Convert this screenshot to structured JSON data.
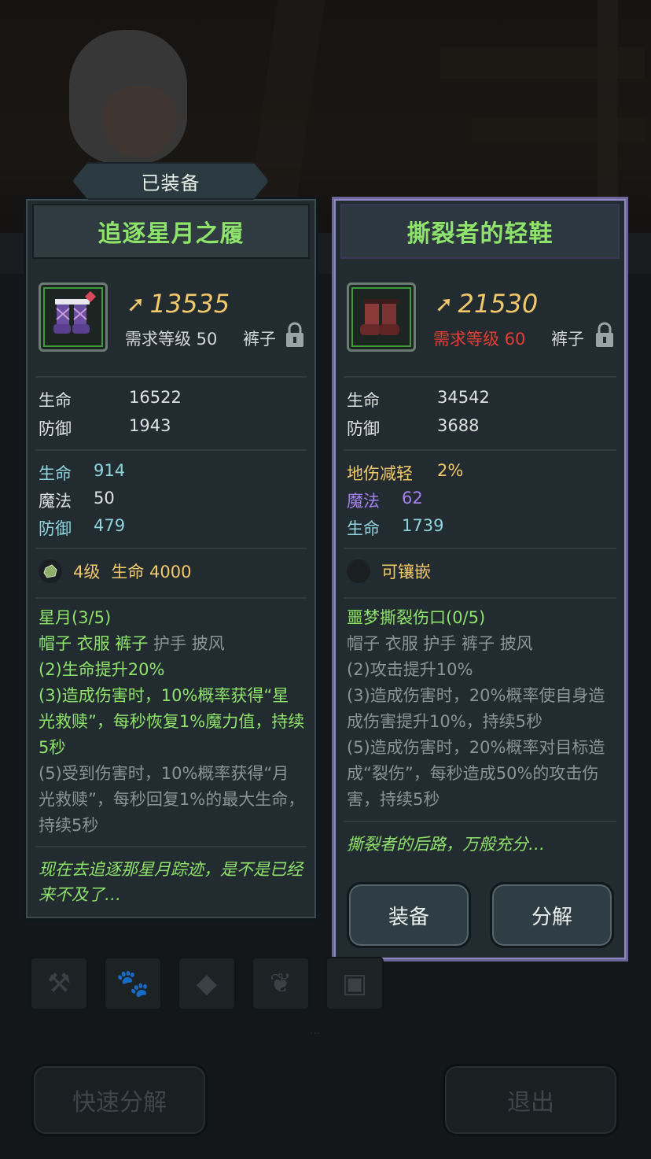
{
  "equipped_tab": {
    "label": "已装备"
  },
  "left_item": {
    "title": "追逐星月之履",
    "power": "13535",
    "required_level": "需求等级 50",
    "slot": "裤子",
    "base_stats": [
      {
        "name": "生命",
        "value": "16522"
      },
      {
        "name": "防御",
        "value": "1943"
      }
    ],
    "bonus_stats": [
      {
        "name": "生命",
        "value": "914",
        "color": "#8fd4df"
      },
      {
        "name": "魔法",
        "value": "50",
        "color": "#dbe3e2"
      },
      {
        "name": "防御",
        "value": "479",
        "color": "#8fd4df"
      }
    ],
    "gem": {
      "level": "4级",
      "bonus": "生命 4000"
    },
    "set": {
      "name": "星月(3/5)",
      "pieces_active": "帽子 衣服 裤子",
      "pieces_inactive": "护手 披风",
      "effect_2": "(2)生命提升20%",
      "effect_3": "(3)造成伤害时，10%概率获得“星光救赎”，每秒恢复1%魔力值，持续5秒",
      "effect_5": "(5)受到伤害时，10%概率获得“月光救赎”，每秒回复1%的最大生命，持续5秒"
    },
    "flavor": "现在去追逐那星月踪迹，是不是已经来不及了…"
  },
  "right_item": {
    "title": "撕裂者的轻鞋",
    "power": "21530",
    "required_level": "需求等级 60",
    "slot": "裤子",
    "base_stats": [
      {
        "name": "生命",
        "value": "34542"
      },
      {
        "name": "防御",
        "value": "3688"
      }
    ],
    "bonus_stats": [
      {
        "name": "地伤减轻",
        "value": "2%",
        "color": "#f1c96b"
      },
      {
        "name": "魔法",
        "value": "62",
        "color": "#a581f0"
      },
      {
        "name": "生命",
        "value": "1739",
        "color": "#8fd4df"
      }
    ],
    "socket": "可镶嵌",
    "set": {
      "name": "噩梦撕裂伤口(0/5)",
      "pieces": "帽子 衣服 护手 裤子 披风",
      "effect_2": "(2)攻击提升10%",
      "effect_3": "(3)造成伤害时，20%概率使自身造成伤害提升10%，持续5秒",
      "effect_5": "(5)造成伤害时，20%概率对目标造成“裂伤”，每秒造成50%的攻击伤害，持续5秒"
    },
    "flavor": "撕裂者的后路，万般充分…",
    "buttons": {
      "equip": "装备",
      "salvage": "分解"
    }
  },
  "bottom": {
    "quick_salvage": "快速分解",
    "exit": "退出"
  },
  "colors": {
    "title_green": "#8ee36a",
    "power_gold": "#f1c96b",
    "level_red": "#e33c32",
    "right_border": "#8f87c2"
  }
}
